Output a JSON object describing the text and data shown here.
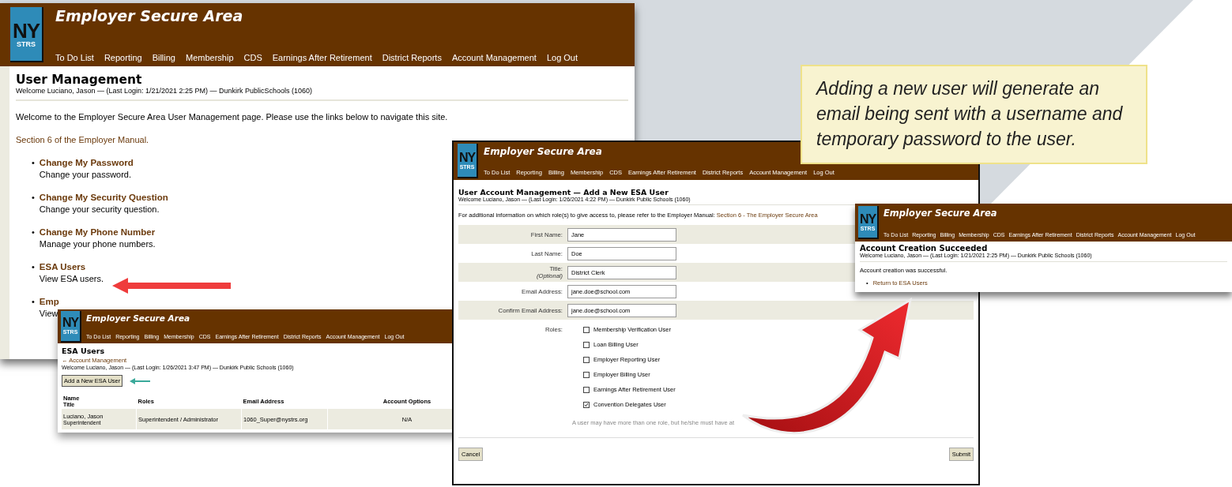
{
  "main_page": {
    "header": {
      "logo": {
        "main": "NY",
        "sub": "STRS"
      },
      "title": "Employer Secure Area",
      "nav": [
        "To Do List",
        "Reporting",
        "Billing",
        "Membership",
        "CDS",
        "Earnings After Retirement",
        "District Reports",
        "Account Management",
        "Log Out"
      ]
    },
    "heading": "User Management",
    "welcome": "Welcome Luciano, Jason — (Last Login: 1/21/2021 2:25 PM) — Dunkirk PublicSchools (1060)",
    "intro": "Welcome to the Employer Secure Area User Management page. Please use the links below to navigate this site.",
    "manual_link": "Section 6 of the Employer Manual.",
    "links": [
      {
        "marker": "•",
        "title": "Change My Password",
        "description": "Change your password."
      },
      {
        "marker": "•",
        "title": "Change My Security Question",
        "description": "Change your security question."
      },
      {
        "marker": "•",
        "title": "Change My Phone Number",
        "description": "Manage your phone numbers."
      },
      {
        "marker": "•",
        "title": "ESA Users",
        "description": "View ESA users."
      },
      {
        "marker": "•",
        "title": "Emp",
        "description": "View"
      }
    ]
  },
  "esa_users_page": {
    "header": {
      "logo": {
        "main": "NY",
        "sub": "STRS"
      },
      "title": "Employer Secure Area",
      "nav": [
        "To Do List",
        "Reporting",
        "Billing",
        "Membership",
        "CDS",
        "Earnings After Retirement",
        "District Reports",
        "Account Management",
        "Log Out"
      ]
    },
    "heading": "ESA Users",
    "back_link": "← Account Management",
    "welcome": "Welcome Luciano, Jason — (Last Login: 1/26/2021 3:47 PM) — Dunkirk Public Schools (1060)",
    "add_button": "Add a New ESA User",
    "columns": [
      {
        "label": "Name",
        "sublabel": "Title"
      },
      {
        "label": "Roles"
      },
      {
        "label": "Email Address"
      },
      {
        "label": "Account Options"
      }
    ],
    "rows": [
      {
        "name": "Luciano, Jason",
        "title": "Superintendent",
        "roles": "Superintendent / Administrator",
        "email": "1060_Super@nystrs.org",
        "account_options": "N/A"
      }
    ]
  },
  "add_user_page": {
    "header": {
      "logo": {
        "main": "NY",
        "sub": "STRS"
      },
      "title": "Employer Secure Area",
      "nav": [
        "To Do List",
        "Reporting",
        "Billing",
        "Membership",
        "CDS",
        "Earnings After Retirement",
        "District Reports",
        "Account Management",
        "Log Out"
      ]
    },
    "heading": "User Account Management — Add a New ESA User",
    "welcome": "Welcome Luciano, Jason — (Last Login: 1/26/2021 4:22 PM) — Dunkirk Public Schools (1060)",
    "info_text": "For additional information on which role(s) to give access to, please refer to the Employer Manual:",
    "info_link": "Section 6 - The Employer Secure Area",
    "fields": [
      {
        "label": "First Name:",
        "value": "Jane"
      },
      {
        "label": "Last Name:",
        "value": "Doe"
      },
      {
        "label": "Title:",
        "note": "(Optional)",
        "value": "District Clerk"
      },
      {
        "label": "Email Address:",
        "value": "jane.doe@school.com"
      },
      {
        "label": "Confirm Email Address:",
        "value": "jane.doe@school.com"
      }
    ],
    "roles_label": "Roles:",
    "roles": [
      {
        "label": "Membership Verification User",
        "checked": false
      },
      {
        "label": "Loan Billing User",
        "checked": false
      },
      {
        "label": "Employer Reporting User",
        "checked": false
      },
      {
        "label": "Employer Billing User",
        "checked": false
      },
      {
        "label": "Earnings After Retirement User",
        "checked": false
      },
      {
        "label": "Convention Delegates User",
        "checked": true
      }
    ],
    "roles_hint": "A user may have more than one role, but he/she must have at",
    "cancel_button": "Cancel",
    "submit_button": "Submit"
  },
  "success_page": {
    "header": {
      "logo": {
        "main": "NY",
        "sub": "STRS"
      },
      "title": "Employer Secure Area",
      "nav": [
        "To Do List",
        "Reporting",
        "Billing",
        "Membership",
        "CDS",
        "Earnings After Retirement",
        "District Reports",
        "Account Management",
        "Log Out"
      ]
    },
    "heading": "Account Creation Succeeded",
    "welcome": "Welcome Luciano, Jason — (Last Login: 1/21/2021 2:25 PM) — Dunkirk Public Schools (1060)",
    "message": "Account creation was successful.",
    "links": [
      {
        "marker": "•",
        "label": "Return to ESA Users"
      }
    ]
  },
  "callout": {
    "text": "Adding a new user will generate an email being sent with a username and temporary password to the user."
  }
}
